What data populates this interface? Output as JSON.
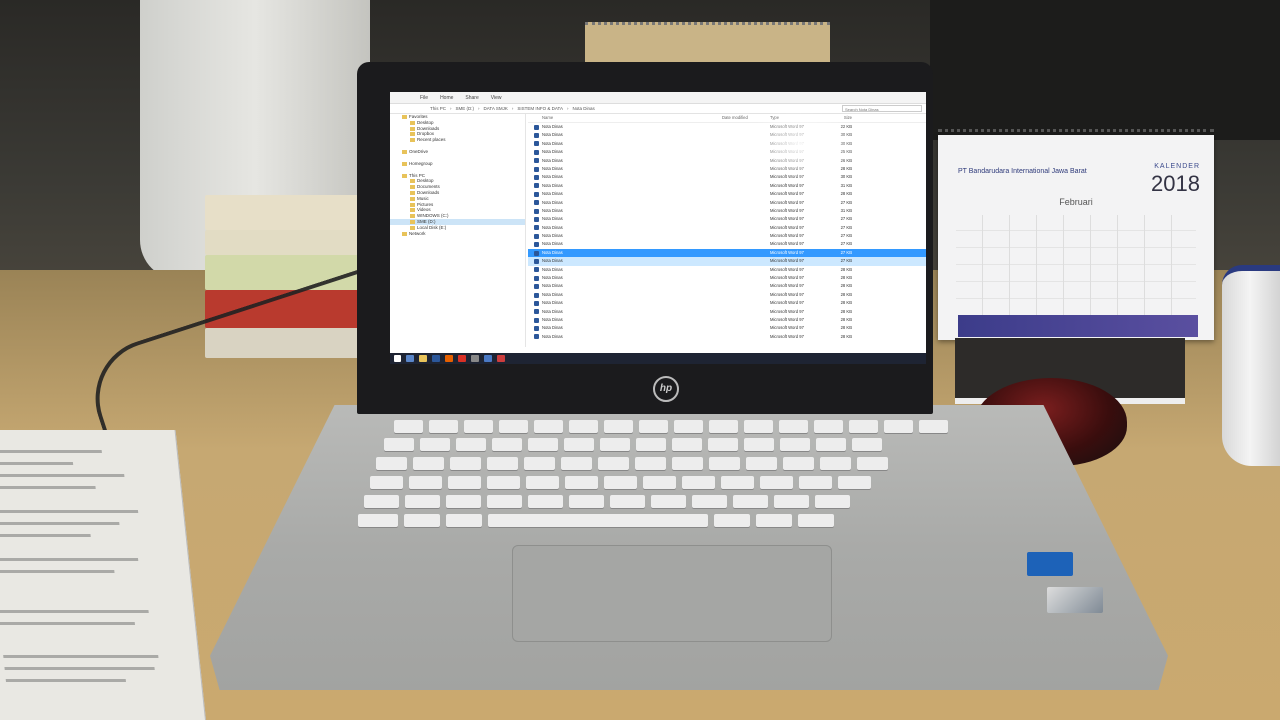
{
  "explorer": {
    "ribbon_tabs": [
      "File",
      "Home",
      "Share",
      "View"
    ],
    "path": [
      "This PC",
      "SME (D:)",
      "DATA SMJK",
      "SISTEM INFO & DATA",
      "Nota Dinas"
    ],
    "search_placeholder": "Search Nota Dinas",
    "columns": {
      "name": "Name",
      "date": "Date modified",
      "type": "Type",
      "size": "Size"
    },
    "nav_items": [
      {
        "label": "Favorites"
      },
      {
        "label": "Desktop"
      },
      {
        "label": "Downloads"
      },
      {
        "label": "Dropbox"
      },
      {
        "label": "Recent places"
      },
      {
        "label": "OneDrive"
      },
      {
        "label": "Homegroup"
      },
      {
        "label": "This PC"
      },
      {
        "label": "Desktop"
      },
      {
        "label": "Documents"
      },
      {
        "label": "Downloads"
      },
      {
        "label": "Music"
      },
      {
        "label": "Pictures"
      },
      {
        "label": "Videos"
      },
      {
        "label": "WINDOWS (C:)"
      },
      {
        "label": "SME (D:)"
      },
      {
        "label": "Local Disk (E:)"
      },
      {
        "label": "Network"
      }
    ],
    "files": [
      {
        "name": "Nota Dinas",
        "date": "",
        "type": "Microsoft Word 97",
        "size": "22 KB"
      },
      {
        "name": "Nota Dinas",
        "date": "",
        "type": "Microsoft Word 97",
        "size": "30 KB"
      },
      {
        "name": "Nota Dinas",
        "date": "",
        "type": "Microsoft Word 97",
        "size": "30 KB"
      },
      {
        "name": "Nota Dinas",
        "date": "",
        "type": "Microsoft Word 97",
        "size": "25 KB"
      },
      {
        "name": "Nota Dinas",
        "date": "",
        "type": "Microsoft Word 97",
        "size": "26 KB"
      },
      {
        "name": "Nota Dinas",
        "date": "",
        "type": "Microsoft Word 97",
        "size": "28 KB"
      },
      {
        "name": "Nota Dinas",
        "date": "",
        "type": "Microsoft Word 97",
        "size": "30 KB"
      },
      {
        "name": "Nota Dinas",
        "date": "",
        "type": "Microsoft Word 97",
        "size": "31 KB"
      },
      {
        "name": "Nota Dinas",
        "date": "",
        "type": "Microsoft Word 97",
        "size": "28 KB"
      },
      {
        "name": "Nota Dinas",
        "date": "",
        "type": "Microsoft Word 97",
        "size": "27 KB"
      },
      {
        "name": "Nota Dinas",
        "date": "",
        "type": "Microsoft Word 97",
        "size": "31 KB"
      },
      {
        "name": "Nota Dinas",
        "date": "",
        "type": "Microsoft Word 97",
        "size": "27 KB"
      },
      {
        "name": "Nota Dinas",
        "date": "",
        "type": "Microsoft Word 97",
        "size": "27 KB"
      },
      {
        "name": "Nota Dinas",
        "date": "",
        "type": "Microsoft Word 97",
        "size": "27 KB"
      },
      {
        "name": "Nota Dinas",
        "date": "",
        "type": "Microsoft Word 97",
        "size": "27 KB"
      },
      {
        "name": "Nota Dinas",
        "date": "",
        "type": "Microsoft Word 97",
        "size": "27 KB"
      },
      {
        "name": "Nota Dinas",
        "date": "",
        "type": "Microsoft Word 97",
        "size": "27 KB"
      },
      {
        "name": "Nota Dinas",
        "date": "",
        "type": "Microsoft Word 97",
        "size": "28 KB"
      },
      {
        "name": "Nota Dinas",
        "date": "",
        "type": "Microsoft Word 97",
        "size": "28 KB"
      },
      {
        "name": "Nota Dinas",
        "date": "",
        "type": "Microsoft Word 97",
        "size": "28 KB"
      },
      {
        "name": "Nota Dinas",
        "date": "",
        "type": "Microsoft Word 97",
        "size": "28 KB"
      },
      {
        "name": "Nota Dinas",
        "date": "",
        "type": "Microsoft Word 97",
        "size": "28 KB"
      },
      {
        "name": "Nota Dinas",
        "date": "",
        "type": "Microsoft Word 97",
        "size": "28 KB"
      },
      {
        "name": "Nota Dinas",
        "date": "",
        "type": "Microsoft Word 97",
        "size": "28 KB"
      },
      {
        "name": "Nota Dinas",
        "date": "",
        "type": "Microsoft Word 97",
        "size": "28 KB"
      },
      {
        "name": "Nota Dinas",
        "date": "",
        "type": "Microsoft Word 97",
        "size": "28 KB"
      }
    ],
    "selected_row": 15,
    "status": ""
  },
  "taskbar": {
    "clock_time": "",
    "clock_date": ""
  },
  "laptop": {
    "brand": "hp"
  },
  "calendar": {
    "kalender": "KALENDER",
    "year": "2018",
    "org": "PT Bandarudara International Jawa Barat",
    "month": "Februari"
  },
  "colors": {
    "taskbar": "#1e2433",
    "selection": "#3399ff",
    "word_icon": "#2b579a",
    "mouse": "#7a1e1e"
  }
}
